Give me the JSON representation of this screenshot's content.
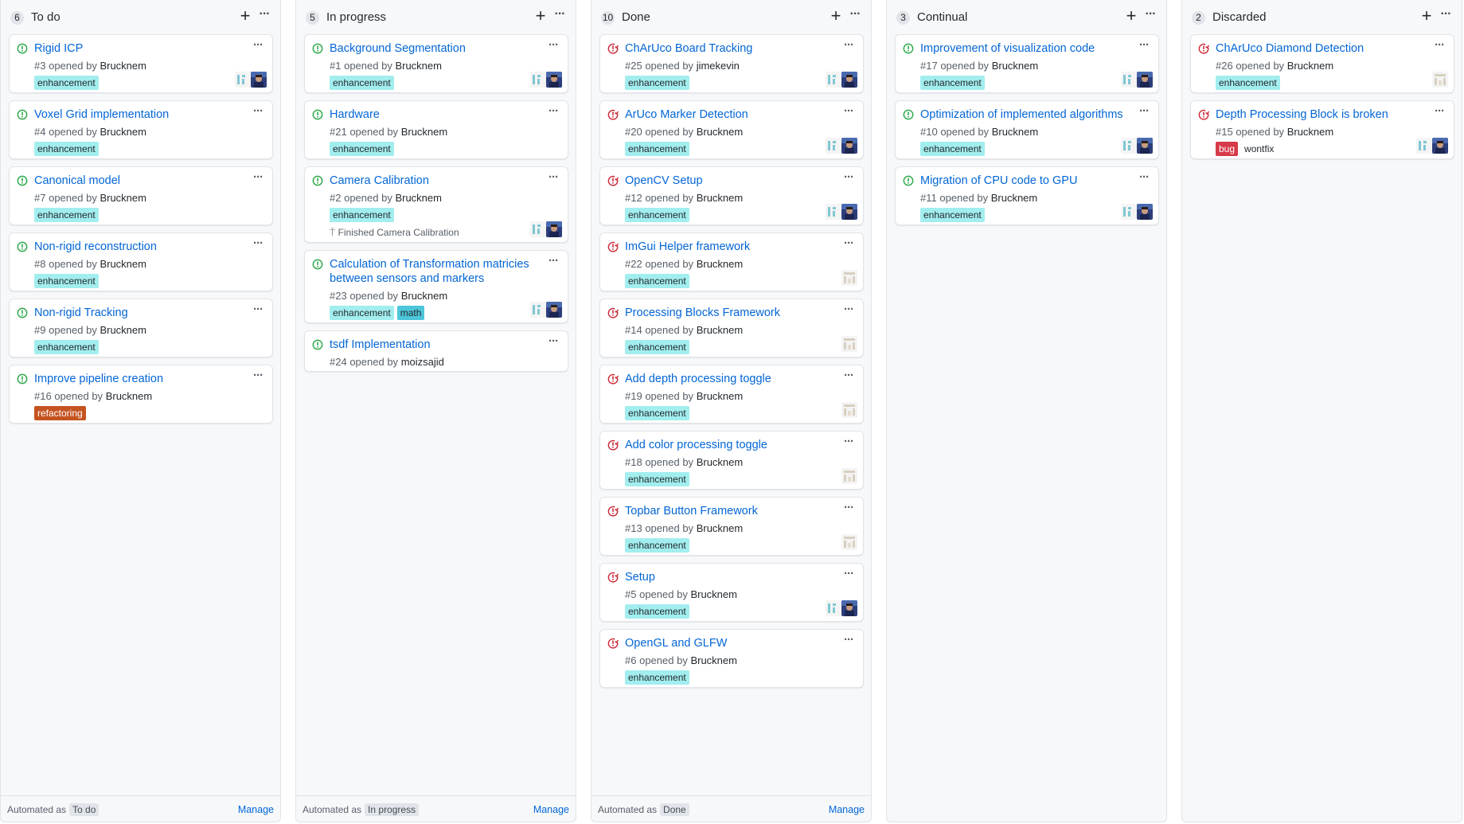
{
  "avatar_colors": {
    "identicon": "#d1d5da",
    "photo": "#2c3e7a",
    "identicon_teal": "#7fc7d3"
  },
  "icons": {
    "open": "issue-opened-icon",
    "closed": "issue-closed-icon",
    "milestone": "milestone-icon",
    "add": "plus-icon",
    "menu": "kebab-menu-icon"
  },
  "columns": [
    {
      "count": "6",
      "title": "To do",
      "automated_prefix": "Automated as",
      "automated_value": "To do",
      "manage": "Manage",
      "cards": [
        {
          "state": "open",
          "title": "Rigid ICP",
          "number": "#3",
          "opened_by": "opened by",
          "author": "Brucknem",
          "labels": [
            {
              "text": "enhancement",
              "bg": "#a2eeef",
              "color": "#24292e"
            }
          ],
          "avatars": [
            "identicon",
            "photo"
          ]
        },
        {
          "state": "open",
          "title": "Voxel Grid implementation",
          "number": "#4",
          "opened_by": "opened by",
          "author": "Brucknem",
          "labels": [
            {
              "text": "enhancement",
              "bg": "#a2eeef",
              "color": "#24292e"
            }
          ],
          "avatars": []
        },
        {
          "state": "open",
          "title": "Canonical model",
          "number": "#7",
          "opened_by": "opened by",
          "author": "Brucknem",
          "labels": [
            {
              "text": "enhancement",
              "bg": "#a2eeef",
              "color": "#24292e"
            }
          ],
          "avatars": []
        },
        {
          "state": "open",
          "title": "Non-rigid reconstruction",
          "number": "#8",
          "opened_by": "opened by",
          "author": "Brucknem",
          "labels": [
            {
              "text": "enhancement",
              "bg": "#a2eeef",
              "color": "#24292e"
            }
          ],
          "avatars": []
        },
        {
          "state": "open",
          "title": "Non-rigid Tracking",
          "number": "#9",
          "opened_by": "opened by",
          "author": "Brucknem",
          "labels": [
            {
              "text": "enhancement",
              "bg": "#a2eeef",
              "color": "#24292e"
            }
          ],
          "avatars": []
        },
        {
          "state": "open",
          "title": "Improve pipeline creation",
          "number": "#16",
          "opened_by": "opened by",
          "author": "Brucknem",
          "labels": [
            {
              "text": "refactoring",
              "bg": "#c5531f",
              "color": "#ffffff"
            }
          ],
          "avatars": []
        }
      ]
    },
    {
      "count": "5",
      "title": "In progress",
      "automated_prefix": "Automated as",
      "automated_value": "In progress",
      "manage": "Manage",
      "cards": [
        {
          "state": "open",
          "title": "Background Segmentation",
          "number": "#1",
          "opened_by": "opened by",
          "author": "Brucknem",
          "labels": [
            {
              "text": "enhancement",
              "bg": "#a2eeef",
              "color": "#24292e"
            }
          ],
          "avatars": [
            "identicon",
            "photo"
          ]
        },
        {
          "state": "open",
          "title": "Hardware",
          "number": "#21",
          "opened_by": "opened by",
          "author": "Brucknem",
          "labels": [
            {
              "text": "enhancement",
              "bg": "#a2eeef",
              "color": "#24292e"
            }
          ],
          "avatars": []
        },
        {
          "state": "open",
          "title": "Camera Calibration",
          "number": "#2",
          "opened_by": "opened by",
          "author": "Brucknem",
          "labels": [
            {
              "text": "enhancement",
              "bg": "#a2eeef",
              "color": "#24292e"
            }
          ],
          "milestone": "Finished Camera Calibration",
          "avatars": [
            "identicon",
            "photo"
          ]
        },
        {
          "state": "open",
          "title": "Calculation of Transformation matricies between sensors and markers",
          "number": "#23",
          "opened_by": "opened by",
          "author": "Brucknem",
          "labels": [
            {
              "text": "enhancement",
              "bg": "#a2eeef",
              "color": "#24292e"
            },
            {
              "text": "math",
              "bg": "#4dc6d9",
              "color": "#24292e"
            }
          ],
          "avatars": [
            "identicon",
            "photo"
          ]
        },
        {
          "state": "open",
          "title": "tsdf Implementation",
          "number": "#24",
          "opened_by": "opened by",
          "author": "moizsajid",
          "labels": [],
          "avatars": []
        }
      ]
    },
    {
      "count": "10",
      "title": "Done",
      "automated_prefix": "Automated as",
      "automated_value": "Done",
      "manage": "Manage",
      "cards": [
        {
          "state": "closed",
          "title": "ChArUco Board Tracking",
          "number": "#25",
          "opened_by": "opened by",
          "author": "jimekevin",
          "labels": [
            {
              "text": "enhancement",
              "bg": "#a2eeef",
              "color": "#24292e"
            }
          ],
          "avatars": [
            "identicon",
            "photo"
          ]
        },
        {
          "state": "closed",
          "title": "ArUco Marker Detection",
          "number": "#20",
          "opened_by": "opened by",
          "author": "Brucknem",
          "labels": [
            {
              "text": "enhancement",
              "bg": "#a2eeef",
              "color": "#24292e"
            }
          ],
          "avatars": [
            "identicon",
            "photo"
          ]
        },
        {
          "state": "closed",
          "title": "OpenCV Setup",
          "number": "#12",
          "opened_by": "opened by",
          "author": "Brucknem",
          "labels": [
            {
              "text": "enhancement",
              "bg": "#a2eeef",
              "color": "#24292e"
            }
          ],
          "avatars": [
            "identicon",
            "photo"
          ]
        },
        {
          "state": "closed",
          "title": "ImGui Helper framework",
          "number": "#22",
          "opened_by": "opened by",
          "author": "Brucknem",
          "labels": [
            {
              "text": "enhancement",
              "bg": "#a2eeef",
              "color": "#24292e"
            }
          ],
          "avatars": [
            "identicon"
          ]
        },
        {
          "state": "closed",
          "title": "Processing Blocks Framework",
          "number": "#14",
          "opened_by": "opened by",
          "author": "Brucknem",
          "labels": [
            {
              "text": "enhancement",
              "bg": "#a2eeef",
              "color": "#24292e"
            }
          ],
          "avatars": [
            "identicon"
          ]
        },
        {
          "state": "closed",
          "title": "Add depth processing toggle",
          "number": "#19",
          "opened_by": "opened by",
          "author": "Brucknem",
          "labels": [
            {
              "text": "enhancement",
              "bg": "#a2eeef",
              "color": "#24292e"
            }
          ],
          "avatars": [
            "identicon"
          ]
        },
        {
          "state": "closed",
          "title": "Add color processing toggle",
          "number": "#18",
          "opened_by": "opened by",
          "author": "Brucknem",
          "labels": [
            {
              "text": "enhancement",
              "bg": "#a2eeef",
              "color": "#24292e"
            }
          ],
          "avatars": [
            "identicon"
          ]
        },
        {
          "state": "closed",
          "title": "Topbar Button Framework",
          "number": "#13",
          "opened_by": "opened by",
          "author": "Brucknem",
          "labels": [
            {
              "text": "enhancement",
              "bg": "#a2eeef",
              "color": "#24292e"
            }
          ],
          "avatars": [
            "identicon"
          ]
        },
        {
          "state": "closed",
          "title": "Setup",
          "number": "#5",
          "opened_by": "opened by",
          "author": "Brucknem",
          "labels": [
            {
              "text": "enhancement",
              "bg": "#a2eeef",
              "color": "#24292e"
            }
          ],
          "avatars": [
            "identicon",
            "photo"
          ]
        },
        {
          "state": "closed",
          "title": "OpenGL and GLFW",
          "number": "#6",
          "opened_by": "opened by",
          "author": "Brucknem",
          "labels": [
            {
              "text": "enhancement",
              "bg": "#a2eeef",
              "color": "#24292e"
            }
          ],
          "avatars": []
        }
      ]
    },
    {
      "count": "3",
      "title": "Continual",
      "automated_prefix": "",
      "automated_value": "",
      "manage": "",
      "cards": [
        {
          "state": "open",
          "title": "Improvement of visualization code",
          "number": "#17",
          "opened_by": "opened by",
          "author": "Brucknem",
          "labels": [
            {
              "text": "enhancement",
              "bg": "#a2eeef",
              "color": "#24292e"
            }
          ],
          "avatars": [
            "identicon",
            "photo"
          ]
        },
        {
          "state": "open",
          "title": "Optimization of implemented algorithms",
          "number": "#10",
          "opened_by": "opened by",
          "author": "Brucknem",
          "labels": [
            {
              "text": "enhancement",
              "bg": "#a2eeef",
              "color": "#24292e"
            }
          ],
          "avatars": [
            "identicon",
            "photo"
          ]
        },
        {
          "state": "open",
          "title": "Migration of CPU code to GPU",
          "number": "#11",
          "opened_by": "opened by",
          "author": "Brucknem",
          "labels": [
            {
              "text": "enhancement",
              "bg": "#a2eeef",
              "color": "#24292e"
            }
          ],
          "avatars": [
            "identicon",
            "photo"
          ]
        }
      ]
    },
    {
      "count": "2",
      "title": "Discarded",
      "automated_prefix": "",
      "automated_value": "",
      "manage": "",
      "cards": [
        {
          "state": "closed",
          "title": "ChArUco Diamond Detection",
          "number": "#26",
          "opened_by": "opened by",
          "author": "Brucknem",
          "labels": [
            {
              "text": "enhancement",
              "bg": "#a2eeef",
              "color": "#24292e"
            }
          ],
          "avatars": [
            "identicon"
          ]
        },
        {
          "state": "closed",
          "title": "Depth Processing Block is broken",
          "number": "#15",
          "opened_by": "opened by",
          "author": "Brucknem",
          "labels": [
            {
              "text": "bug",
              "bg": "#d73a4a",
              "color": "#ffffff"
            },
            {
              "text": "wontfix",
              "bg": "#ffffff",
              "color": "#24292e"
            }
          ],
          "avatars": [
            "identicon",
            "photo"
          ]
        }
      ]
    }
  ]
}
